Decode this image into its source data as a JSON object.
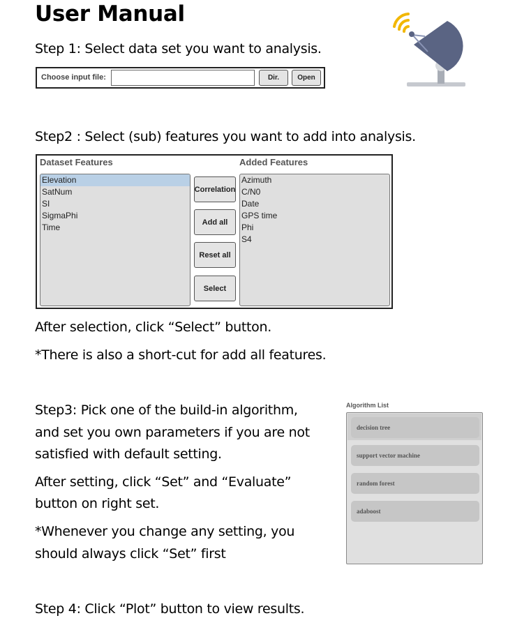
{
  "title": "User Manual",
  "step1": {
    "text": "Step 1: Select data set you want to analysis.",
    "file_label": "Choose input file:",
    "file_value": "",
    "dir_button": "Dir.",
    "open_button": "Open"
  },
  "step2": {
    "text": "Step2 : Select (sub) features you want to add into analysis.",
    "dataset_header": "Dataset Features",
    "added_header": "Added Features",
    "dataset_items": [
      "Elevation",
      "SatNum",
      "SI",
      "SigmaPhi",
      "Time"
    ],
    "selected_item": "Elevation",
    "added_items": [
      "Azimuth",
      "C/N0",
      "Date",
      "GPS time",
      "Phi",
      "S4"
    ],
    "buttons": {
      "correlation": "Correlation",
      "add_all": "Add all",
      "reset_all": "Reset all",
      "select": "Select"
    },
    "after_text": "After selection, click “Select” button.",
    "shortcut_text": "*There is also a short-cut for add all features."
  },
  "step3": {
    "line1": "Step3: Pick one of the build-in algorithm,",
    "line2": "and set you own parameters if you are not",
    "line3": "satisfied with default setting.",
    "line4": "After setting, click “Set” and “Evaluate”",
    "line5": "button on right set.",
    "line6": "*Whenever you change any setting, you",
    "line7": "should always click “Set” first"
  },
  "algorithm_list": {
    "label": "Algorithm List",
    "items": [
      "decision tree",
      "support vector machine",
      "random forest",
      "adaboost"
    ]
  },
  "step4": {
    "text": "Step 4: Click “Plot” button to view results."
  },
  "colors": {
    "selected_item_bg": "#b9d0e6",
    "dish_body": "#5a6483",
    "signal_arcs": "#f2b705"
  },
  "icons": [
    "satellite-dish-icon"
  ]
}
